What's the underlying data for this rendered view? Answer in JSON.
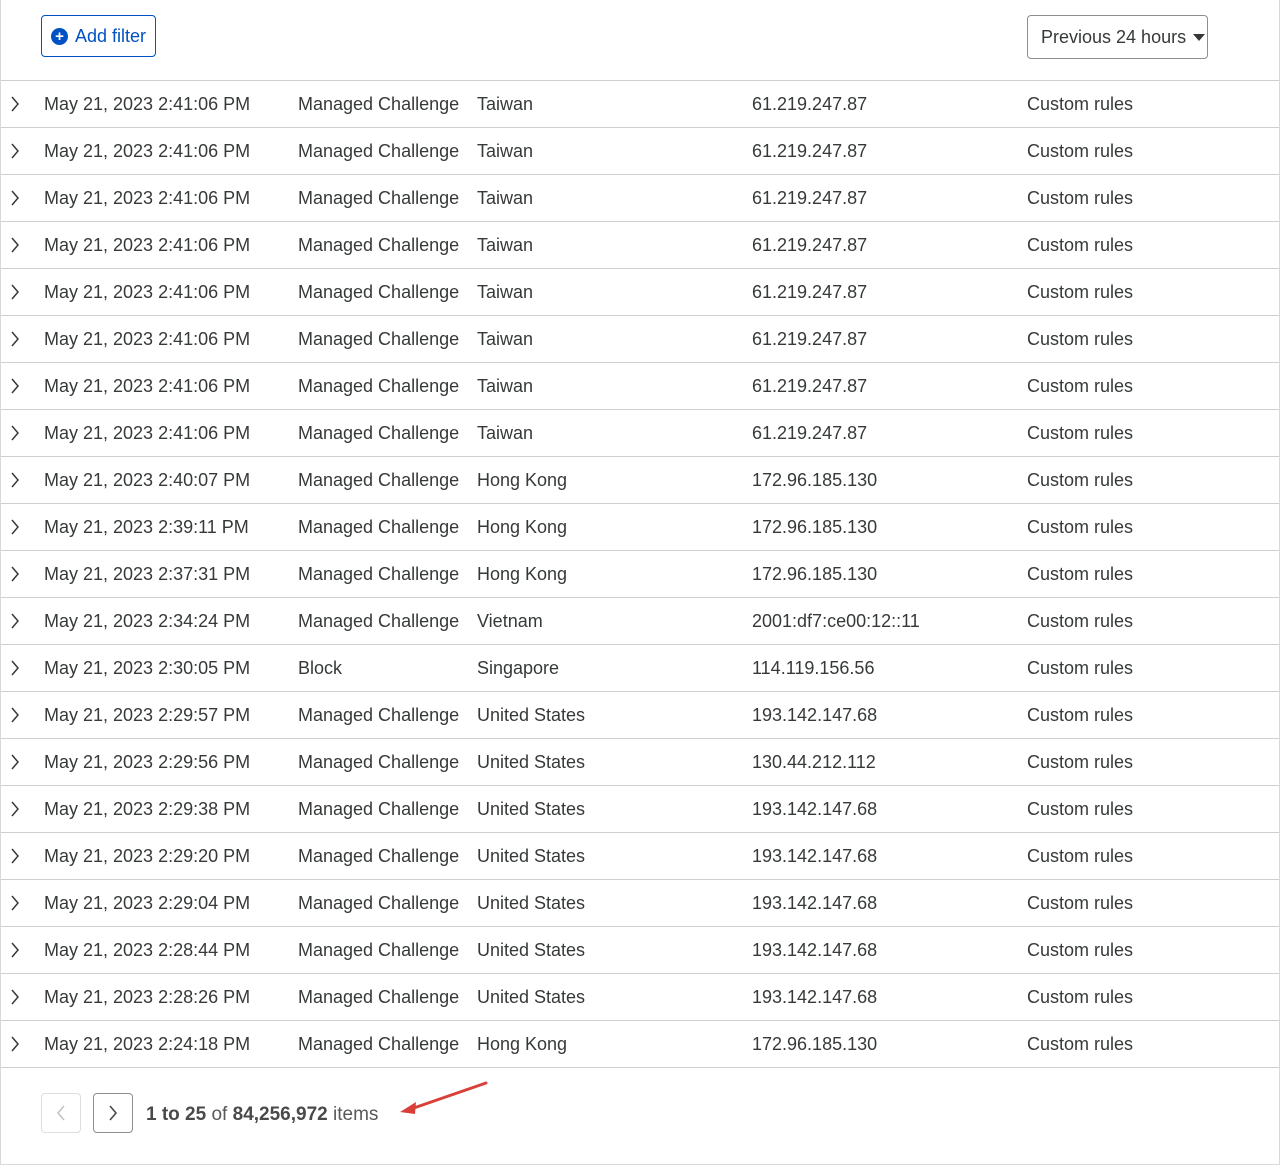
{
  "toolbar": {
    "add_filter_label": "Add filter",
    "time_range_label": "Previous 24 hours"
  },
  "rows": [
    {
      "date": "May 21, 2023 2:41:06 PM",
      "action": "Managed Challenge",
      "country": "Taiwan",
      "ip": "61.219.247.87",
      "service": "Custom rules"
    },
    {
      "date": "May 21, 2023 2:41:06 PM",
      "action": "Managed Challenge",
      "country": "Taiwan",
      "ip": "61.219.247.87",
      "service": "Custom rules"
    },
    {
      "date": "May 21, 2023 2:41:06 PM",
      "action": "Managed Challenge",
      "country": "Taiwan",
      "ip": "61.219.247.87",
      "service": "Custom rules"
    },
    {
      "date": "May 21, 2023 2:41:06 PM",
      "action": "Managed Challenge",
      "country": "Taiwan",
      "ip": "61.219.247.87",
      "service": "Custom rules"
    },
    {
      "date": "May 21, 2023 2:41:06 PM",
      "action": "Managed Challenge",
      "country": "Taiwan",
      "ip": "61.219.247.87",
      "service": "Custom rules"
    },
    {
      "date": "May 21, 2023 2:41:06 PM",
      "action": "Managed Challenge",
      "country": "Taiwan",
      "ip": "61.219.247.87",
      "service": "Custom rules"
    },
    {
      "date": "May 21, 2023 2:41:06 PM",
      "action": "Managed Challenge",
      "country": "Taiwan",
      "ip": "61.219.247.87",
      "service": "Custom rules"
    },
    {
      "date": "May 21, 2023 2:41:06 PM",
      "action": "Managed Challenge",
      "country": "Taiwan",
      "ip": "61.219.247.87",
      "service": "Custom rules"
    },
    {
      "date": "May 21, 2023 2:40:07 PM",
      "action": "Managed Challenge",
      "country": "Hong Kong",
      "ip": "172.96.185.130",
      "service": "Custom rules"
    },
    {
      "date": "May 21, 2023 2:39:11 PM",
      "action": "Managed Challenge",
      "country": "Hong Kong",
      "ip": "172.96.185.130",
      "service": "Custom rules"
    },
    {
      "date": "May 21, 2023 2:37:31 PM",
      "action": "Managed Challenge",
      "country": "Hong Kong",
      "ip": "172.96.185.130",
      "service": "Custom rules"
    },
    {
      "date": "May 21, 2023 2:34:24 PM",
      "action": "Managed Challenge",
      "country": "Vietnam",
      "ip": "2001:df7:ce00:12::11",
      "service": "Custom rules"
    },
    {
      "date": "May 21, 2023 2:30:05 PM",
      "action": "Block",
      "country": "Singapore",
      "ip": "114.119.156.56",
      "service": "Custom rules"
    },
    {
      "date": "May 21, 2023 2:29:57 PM",
      "action": "Managed Challenge",
      "country": "United States",
      "ip": "193.142.147.68",
      "service": "Custom rules"
    },
    {
      "date": "May 21, 2023 2:29:56 PM",
      "action": "Managed Challenge",
      "country": "United States",
      "ip": "130.44.212.112",
      "service": "Custom rules"
    },
    {
      "date": "May 21, 2023 2:29:38 PM",
      "action": "Managed Challenge",
      "country": "United States",
      "ip": "193.142.147.68",
      "service": "Custom rules"
    },
    {
      "date": "May 21, 2023 2:29:20 PM",
      "action": "Managed Challenge",
      "country": "United States",
      "ip": "193.142.147.68",
      "service": "Custom rules"
    },
    {
      "date": "May 21, 2023 2:29:04 PM",
      "action": "Managed Challenge",
      "country": "United States",
      "ip": "193.142.147.68",
      "service": "Custom rules"
    },
    {
      "date": "May 21, 2023 2:28:44 PM",
      "action": "Managed Challenge",
      "country": "United States",
      "ip": "193.142.147.68",
      "service": "Custom rules"
    },
    {
      "date": "May 21, 2023 2:28:26 PM",
      "action": "Managed Challenge",
      "country": "United States",
      "ip": "193.142.147.68",
      "service": "Custom rules"
    },
    {
      "date": "May 21, 2023 2:24:18 PM",
      "action": "Managed Challenge",
      "country": "Hong Kong",
      "ip": "172.96.185.130",
      "service": "Custom rules"
    }
  ],
  "pagination": {
    "range": "1 to 25",
    "of_word": "of",
    "total": "84,256,972",
    "unit": "items"
  },
  "colors": {
    "accent": "#0051c3",
    "annotation_arrow": "#d9403a",
    "row_border": "#d0d0d0"
  }
}
